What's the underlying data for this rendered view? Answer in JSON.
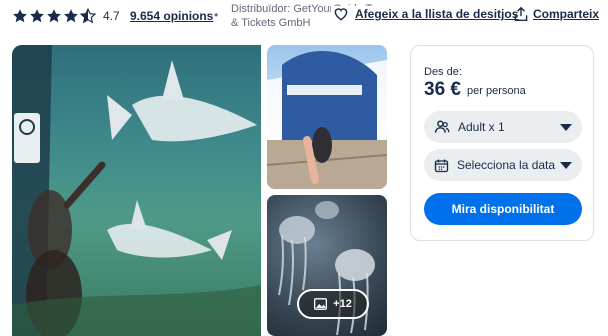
{
  "header": {
    "rating": "4.7",
    "reviews_label": "9.654 opinions",
    "separator": "•",
    "supplier_text": "Distribuïdor: GetYourGuide Tours & Tickets GmbH",
    "wishlist_label": "Afegeix a la llista de desitjos",
    "share_label": "Comparteix",
    "stars_filled": 4.5
  },
  "gallery": {
    "more_photos_label": "+12"
  },
  "booking": {
    "from_label": "Des de:",
    "price": "36 €",
    "per_person_label": "per persona",
    "participants_value": "Adult x 1",
    "date_value": "Selecciona la data",
    "cta_label": "Mira disponibilitat"
  },
  "colors": {
    "text": "#1a2b49",
    "accent": "#0071eb",
    "field_bg": "#ebeef1"
  }
}
